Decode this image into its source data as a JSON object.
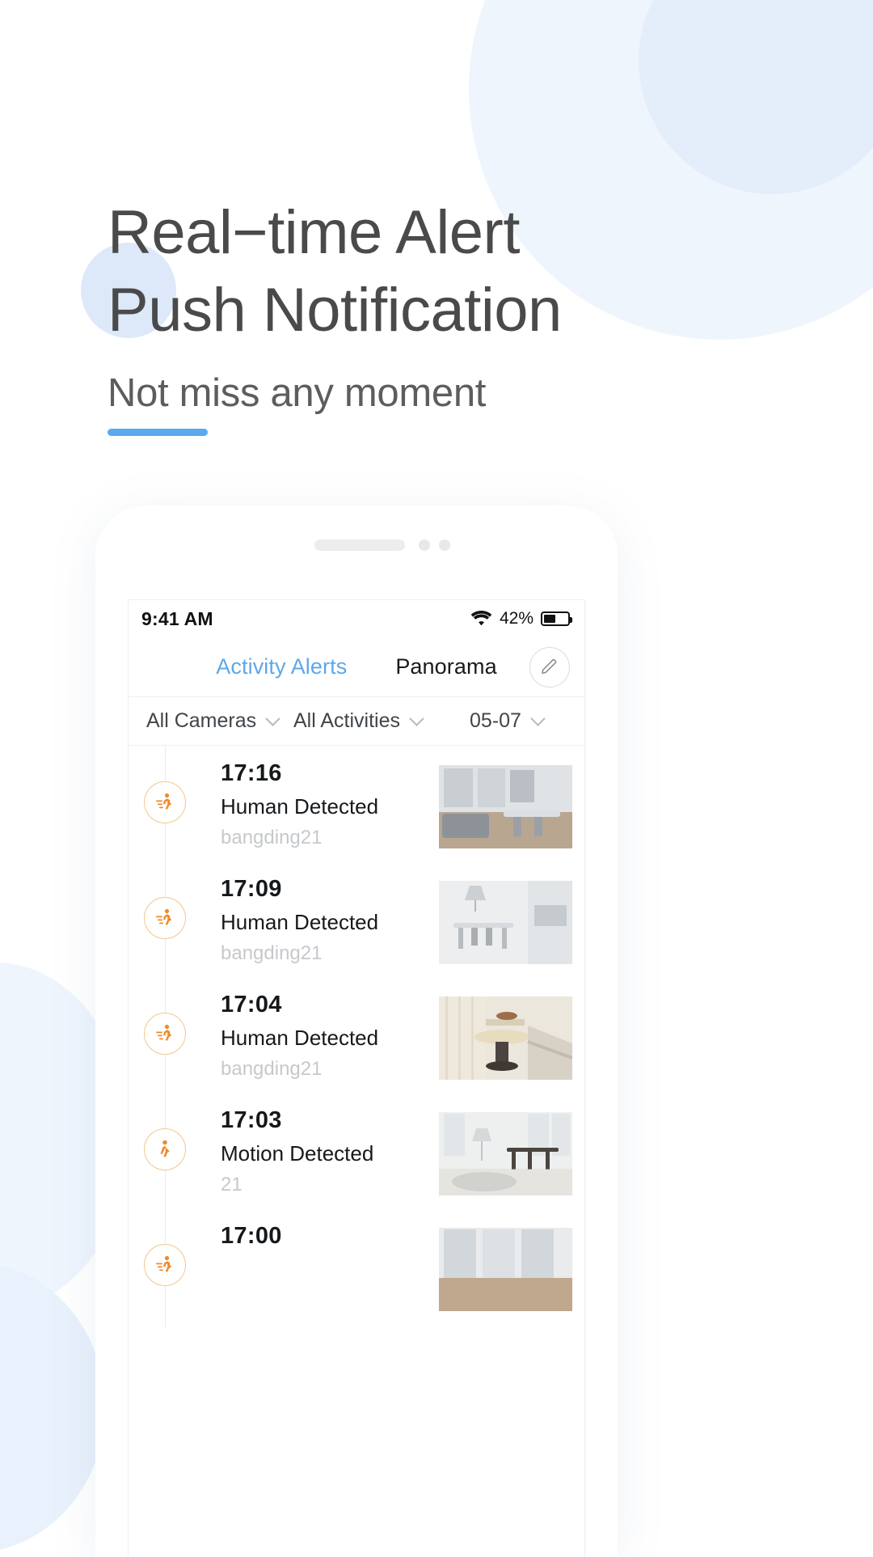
{
  "hero": {
    "headline_line1": "Real−time Alert",
    "headline_line2": "Push Notification",
    "subtitle": "Not miss any moment",
    "accent_color": "#5da9ee"
  },
  "phone": {
    "status_bar": {
      "time": "9:41 AM",
      "wifi_icon": "wifi-icon",
      "battery_percent": "42%",
      "battery_icon": "battery-icon"
    },
    "tabs": [
      {
        "label": "Activity Alerts",
        "active": true
      },
      {
        "label": "Panorama",
        "active": false
      }
    ],
    "edit_button_icon": "pencil-icon",
    "filters": [
      {
        "label": "All Cameras",
        "icon": "chevron-down-icon"
      },
      {
        "label": "All Activities",
        "icon": "chevron-down-icon"
      },
      {
        "label": "05-07",
        "icon": "chevron-down-icon"
      }
    ],
    "activities": [
      {
        "time": "17:16",
        "title": "Human Detected",
        "device": "bangding21",
        "icon": "human-detected-icon"
      },
      {
        "time": "17:09",
        "title": "Human Detected",
        "device": "bangding21",
        "icon": "human-detected-icon"
      },
      {
        "time": "17:04",
        "title": "Human Detected",
        "device": "bangding21",
        "icon": "human-detected-icon"
      },
      {
        "time": "17:03",
        "title": "Motion Detected",
        "device": "21",
        "icon": "motion-detected-icon"
      },
      {
        "time": "17:00",
        "title": "",
        "device": "",
        "icon": "human-detected-icon"
      }
    ]
  },
  "colors": {
    "tab_active": "#5ea8e8",
    "badge_orange": "#ef8b2c",
    "text_primary": "#16191c",
    "text_muted": "#c6c9cc"
  }
}
